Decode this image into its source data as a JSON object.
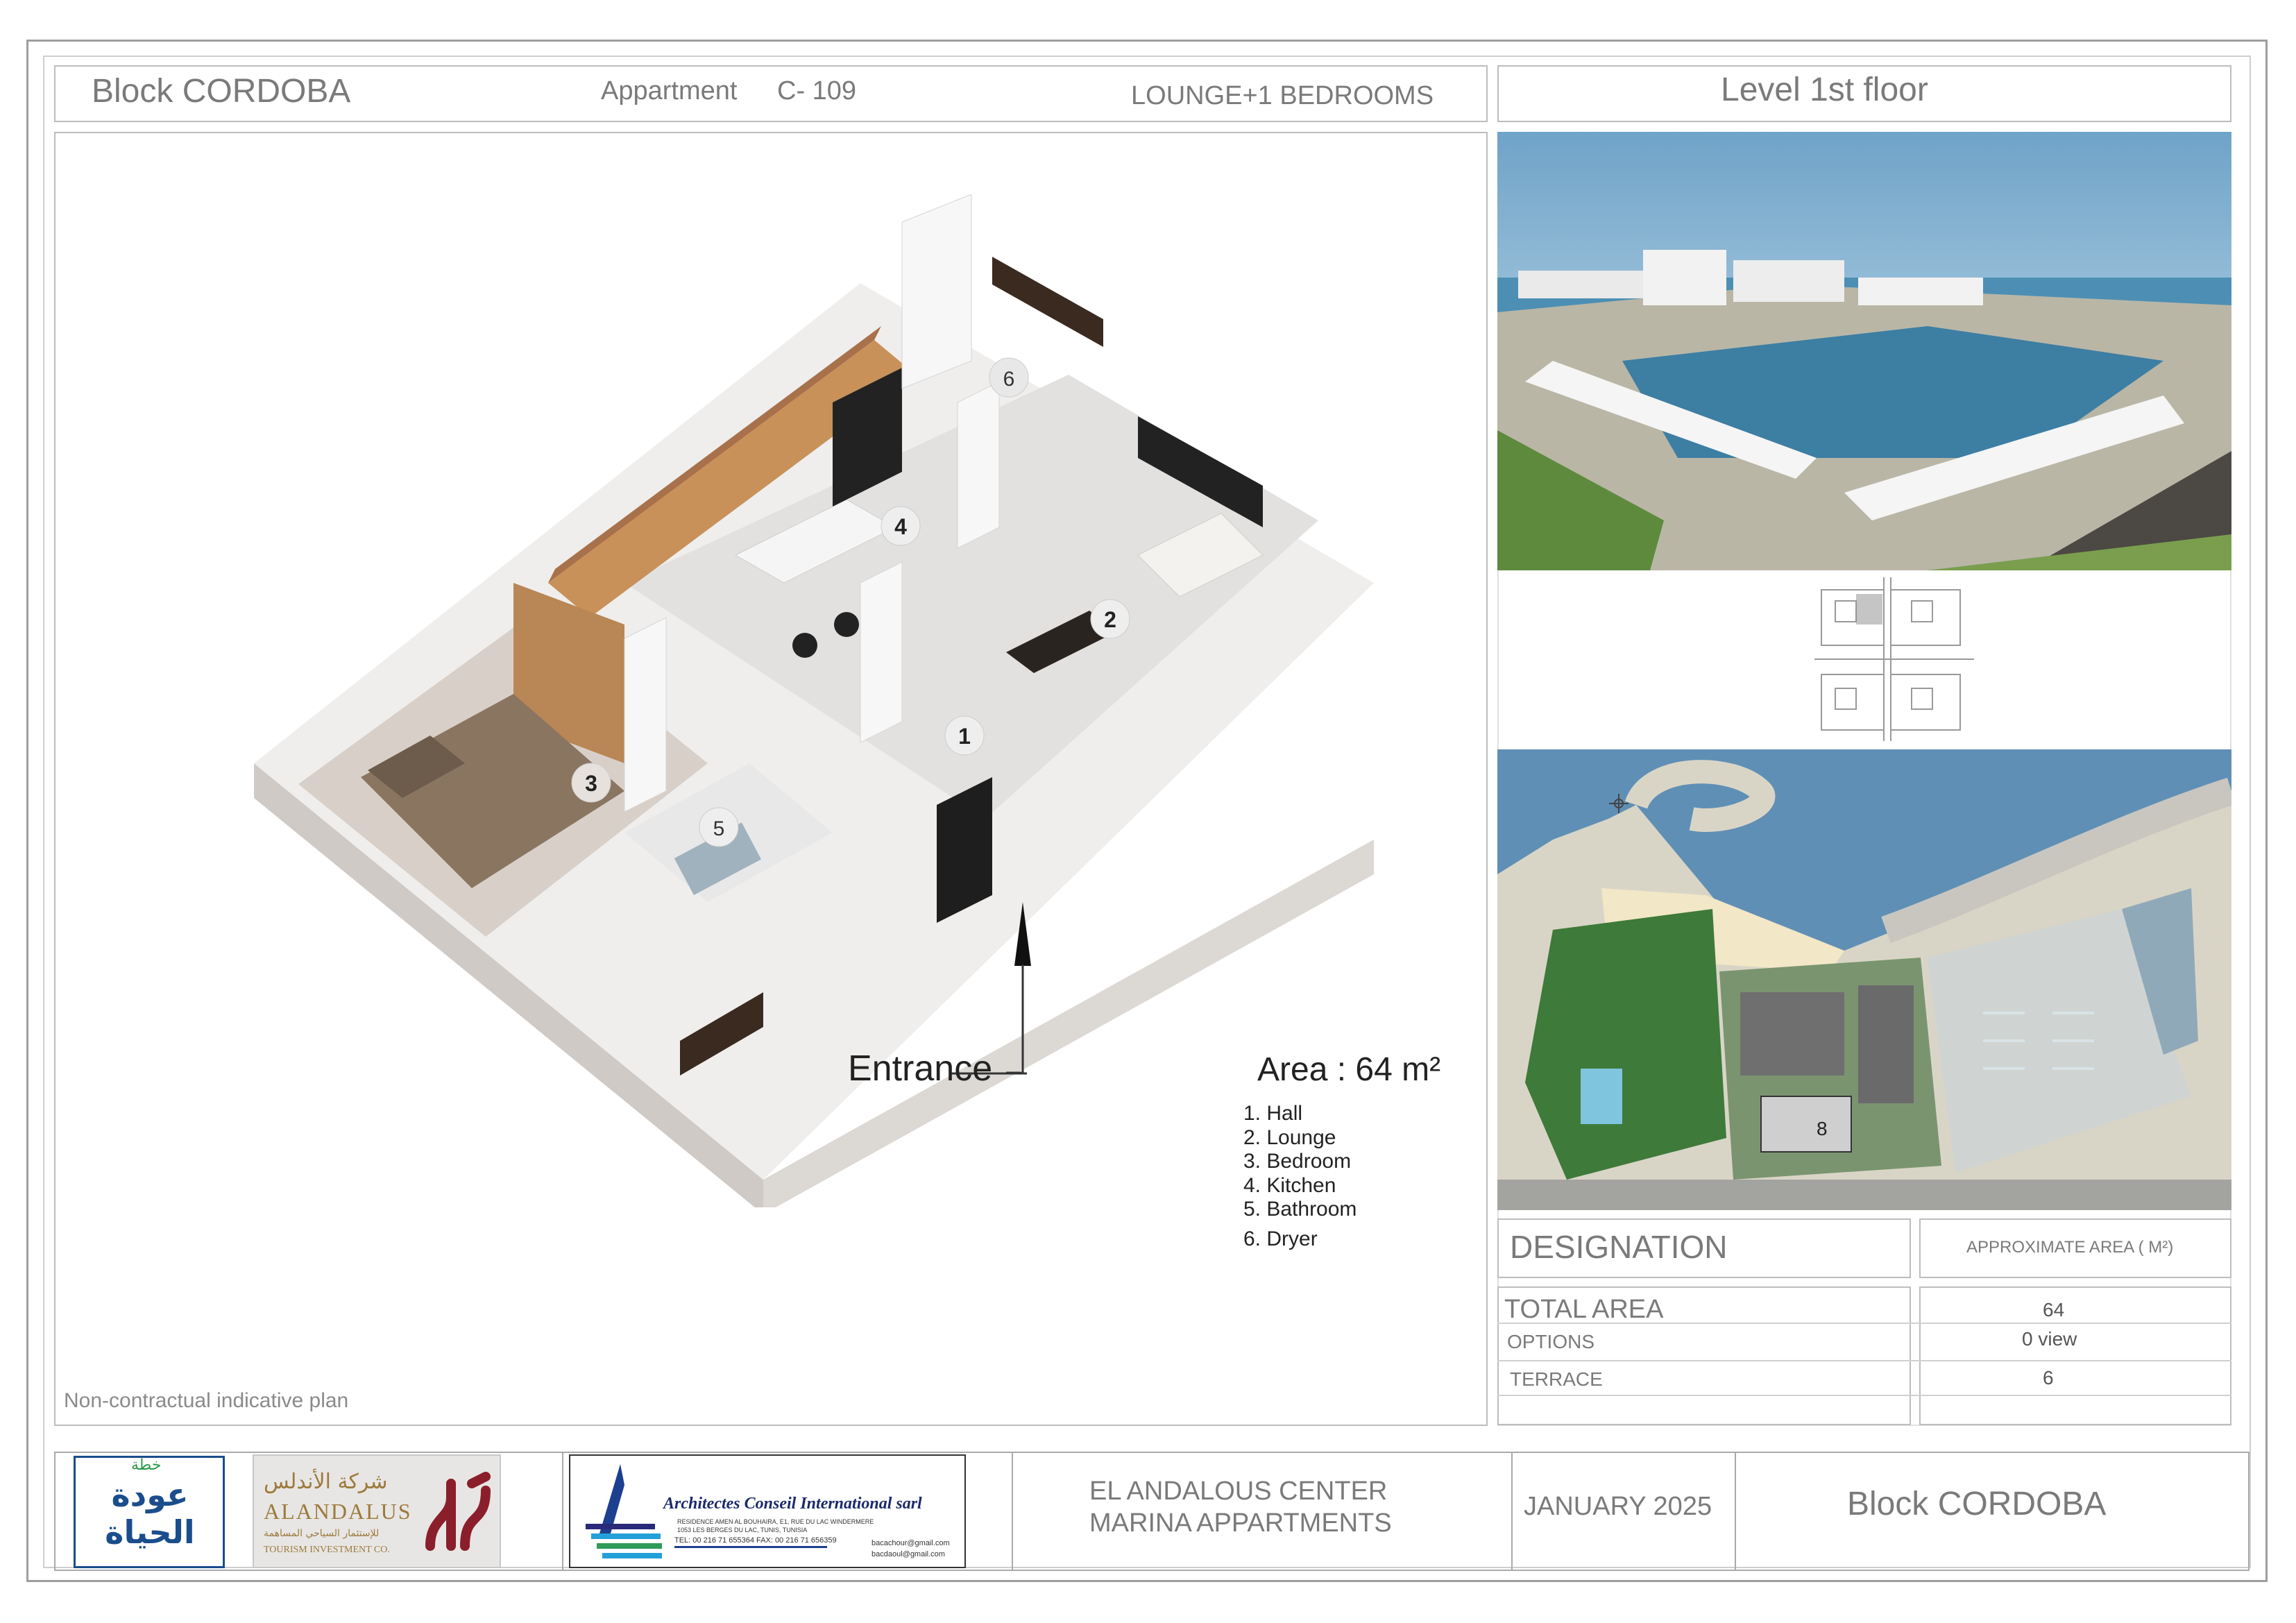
{
  "header": {
    "block": "Block CORDOBA",
    "apartment_label": "Appartment",
    "apartment_code": "C- 109",
    "type": "LOUNGE+1 BEDROOMS",
    "level": "Level 1st floor"
  },
  "plan": {
    "room_numbers": [
      "1",
      "2",
      "3",
      "4",
      "5",
      "6"
    ],
    "entrance": "Entrance",
    "area": "Area : 64 m²",
    "legend": [
      "1. Hall",
      "2. Lounge",
      "3. Bedroom",
      "4. Kitchen",
      "5. Bathroom",
      "6. Dryer"
    ],
    "note": "Non-contractual indicative plan"
  },
  "masterplan": {
    "building_number": "8"
  },
  "table": {
    "designation": "DESIGNATION",
    "approx_area": "APPROXIMATE AREA  ( M²)",
    "rows": [
      {
        "label": "TOTAL AREA",
        "value": "64"
      },
      {
        "label": "OPTIONS",
        "value": "0 view"
      },
      {
        "label": "TERRACE",
        "value": "6"
      }
    ]
  },
  "footer": {
    "logo1": {
      "arabic_top": "خطة",
      "arabic_main": "عودة الحياة"
    },
    "logo2": {
      "arabic": "شركة الأندلس",
      "name": "ALANDALUS",
      "arabic_sub": "للإستثمار السياحي المساهمة",
      "sub": "TOURISM INVESTMENT CO."
    },
    "architect": {
      "name": "Architectes  Conseil  International sarl",
      "address1": "RESIDENCE AMEN AL BOUHAIRA, E1, RUE DU LAC WINDERMERE",
      "address2": "1053 LES BERGES DU LAC, TUNIS, TUNISIA",
      "phone": "TEL: 00 216 71 655364   FAX: 00 216 71 656359",
      "email1": "bacachour@gmail.com",
      "email2": "bacdaoul@gmail.com"
    },
    "project1": "EL ANDALOUS CENTER",
    "project2": "MARINA APPARTMENTS",
    "date": "JANUARY  2025",
    "block": "Block  CORDOBA"
  },
  "colors": {
    "border": "#bdbdbd",
    "sea": "#3f7fa8",
    "wood": "#c8915a",
    "wall": "#e9e6e3",
    "green": "#2f6f3a"
  }
}
